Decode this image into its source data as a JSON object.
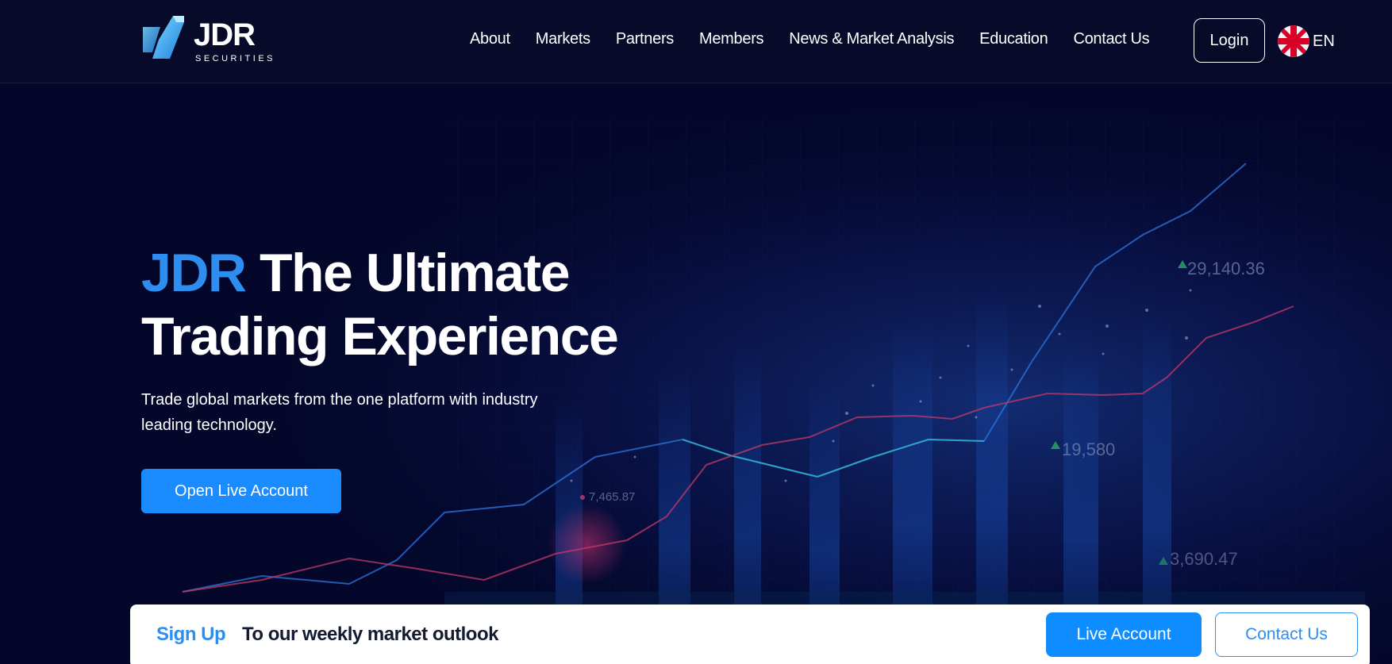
{
  "brand": {
    "name": "JDR",
    "sub": "SECURITIES"
  },
  "nav": {
    "items": [
      {
        "label": "About"
      },
      {
        "label": "Markets"
      },
      {
        "label": "Partners"
      },
      {
        "label": "Members"
      },
      {
        "label": "News & Market Analysis"
      },
      {
        "label": "Education"
      },
      {
        "label": "Contact Us"
      }
    ],
    "login_label": "Login",
    "lang_label": "EN",
    "flag_icon": "uk-flag-icon"
  },
  "hero": {
    "title_accent": "JDR",
    "title_line1_rest": " The Ultimate",
    "title_line2": "Trading Experience",
    "subtitle": "Trade global markets from the one platform with industry leading technology.",
    "cta_label": "Open Live Account",
    "ticker_values": [
      "29,140.36",
      "19,580",
      "7,465.87",
      "3,690.47"
    ]
  },
  "signup_bar": {
    "label": "Sign Up",
    "text": "To our weekly market outlook",
    "live_label": "Live Account",
    "contact_label": "Contact Us"
  },
  "colors": {
    "accent": "#2e8ef0",
    "button": "#1a8cff",
    "background": "#05082a"
  }
}
